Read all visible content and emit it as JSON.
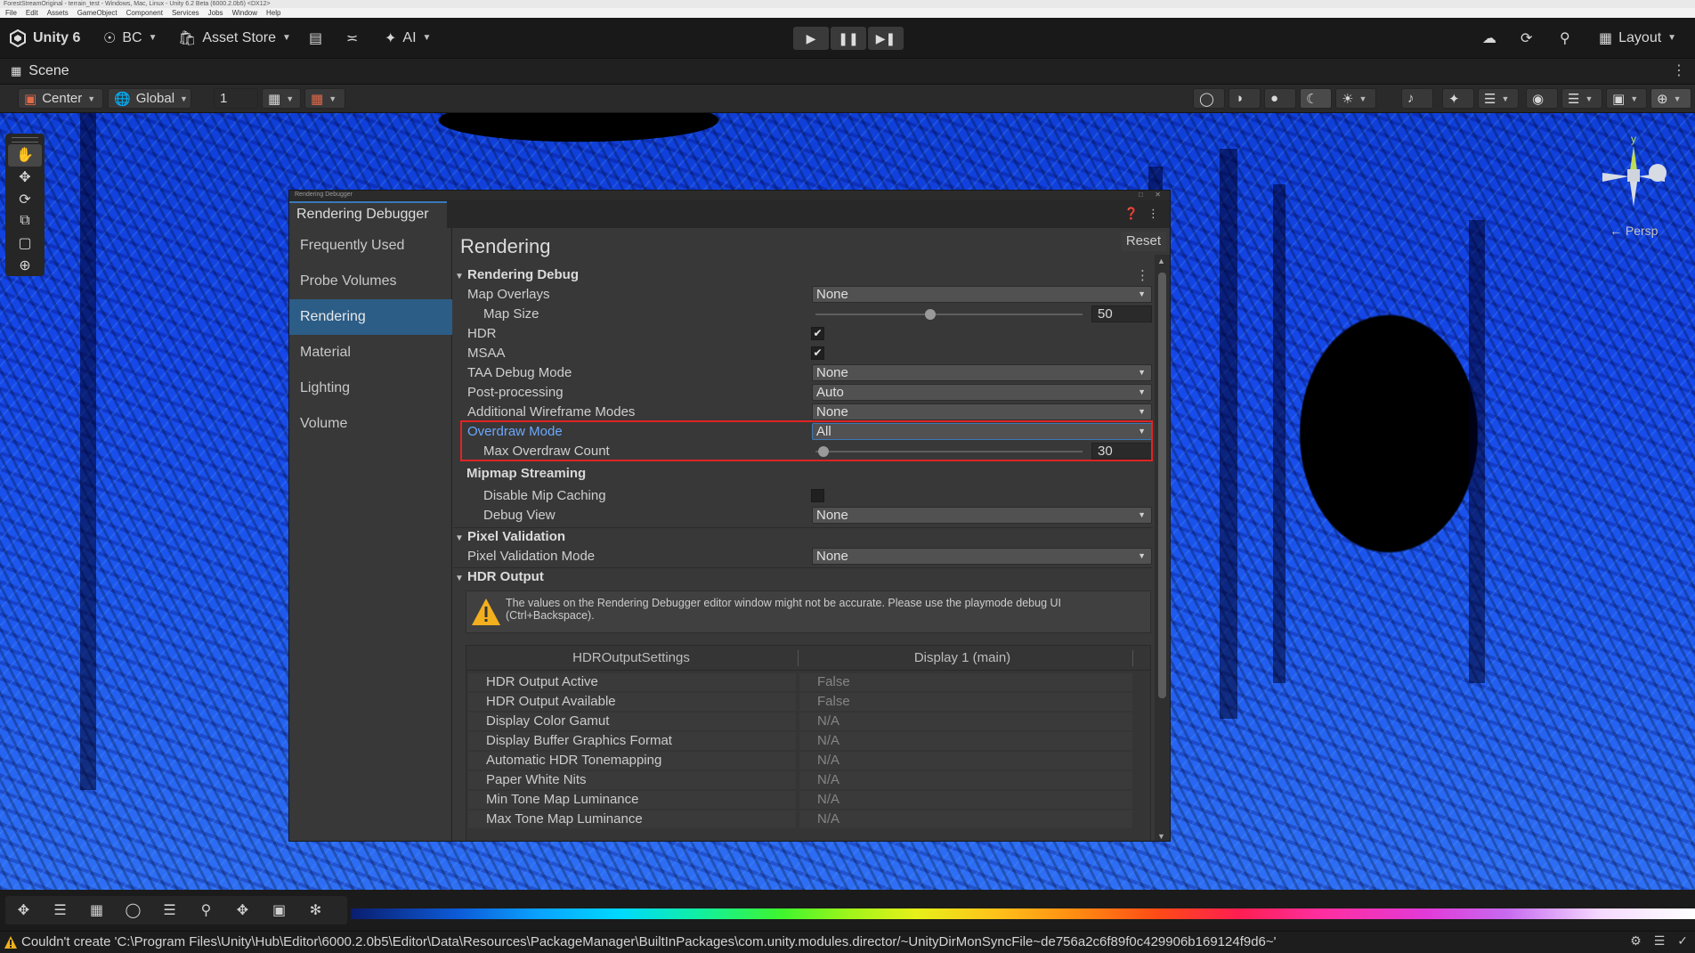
{
  "os": {
    "title": "ForestStreamOriginal - terrain_test - Windows, Mac, Linux - Unity 6.2 Beta (6000.2.0b5) <DX12>",
    "menu": [
      "File",
      "Edit",
      "Assets",
      "GameObject",
      "Component",
      "Services",
      "Jobs",
      "Window",
      "Help"
    ]
  },
  "toolbar": {
    "app_name": "Unity 6",
    "account": "BC",
    "asset_store": "Asset Store",
    "ai": "AI",
    "layout": "Layout"
  },
  "scene": {
    "tab_title": "Scene",
    "pivot": "Center",
    "space": "Global",
    "snap_value": "1",
    "persp_label": "← Persp",
    "gizmo_axis": "y"
  },
  "debugger": {
    "window_title": "Rendering Debugger",
    "tab_label": "Rendering Debugger",
    "reset_label": "Reset",
    "sidebar": [
      "Frequently Used",
      "Probe Volumes",
      "Rendering",
      "Material",
      "Lighting",
      "Volume"
    ],
    "selected_item": "Rendering",
    "panel_title": "Rendering",
    "sections": {
      "rendering_debug": "Rendering Debug",
      "mipmap_streaming": "Mipmap Streaming",
      "pixel_validation": "Pixel Validation",
      "hdr_output": "HDR Output"
    },
    "fields": {
      "map_overlays": {
        "label": "Map Overlays",
        "value": "None"
      },
      "map_size": {
        "label": "Map Size",
        "value": "50",
        "fraction": 0.43
      },
      "hdr": {
        "label": "HDR",
        "checked": "✔"
      },
      "msaa": {
        "label": "MSAA",
        "checked": "✔"
      },
      "taa_debug_mode": {
        "label": "TAA Debug Mode",
        "value": "None"
      },
      "post_processing": {
        "label": "Post-processing",
        "value": "Auto"
      },
      "additional_wireframe": {
        "label": "Additional Wireframe Modes",
        "value": "None"
      },
      "overdraw_mode": {
        "label": "Overdraw Mode",
        "value": "All"
      },
      "max_overdraw_count": {
        "label": "Max Overdraw Count",
        "value": "30",
        "fraction": 0.03
      },
      "disable_mip_caching": {
        "label": "Disable Mip Caching",
        "checked": ""
      },
      "debug_view": {
        "label": "Debug View",
        "value": "None"
      },
      "pixel_validation_mode": {
        "label": "Pixel Validation Mode",
        "value": "None"
      }
    },
    "warning_text": "The values on the Rendering Debugger editor window might not be accurate. Please use the playmode debug UI (Ctrl+Backspace).",
    "hdr_table": {
      "headers": [
        "HDROutputSettings",
        "Display 1 (main)"
      ],
      "rows": [
        {
          "k": "HDR Output Active",
          "v": "False"
        },
        {
          "k": "HDR Output Available",
          "v": "False"
        },
        {
          "k": "Display Color Gamut",
          "v": "N/A"
        },
        {
          "k": "Display Buffer Graphics Format",
          "v": "N/A"
        },
        {
          "k": "Automatic HDR Tonemapping",
          "v": "N/A"
        },
        {
          "k": "Paper White Nits",
          "v": "N/A"
        },
        {
          "k": "Min Tone Map Luminance",
          "v": "N/A"
        },
        {
          "k": "Max Tone Map Luminance",
          "v": "N/A"
        }
      ]
    }
  },
  "status": {
    "message": "Couldn't create 'C:\\Program Files\\Unity\\Hub\\Editor\\6000.2.0b5\\Editor\\Data\\Resources\\PackageManager\\BuiltInPackages\\com.unity.modules.director/~UnityDirMonSyncFile~de756a2c6f89f0c429906b169124f9d6~'"
  },
  "colors": {
    "accent": "#3a79bb",
    "selection": "#2c5d87",
    "highlight_frame": "#e02424",
    "warning": "#f2b01e"
  }
}
